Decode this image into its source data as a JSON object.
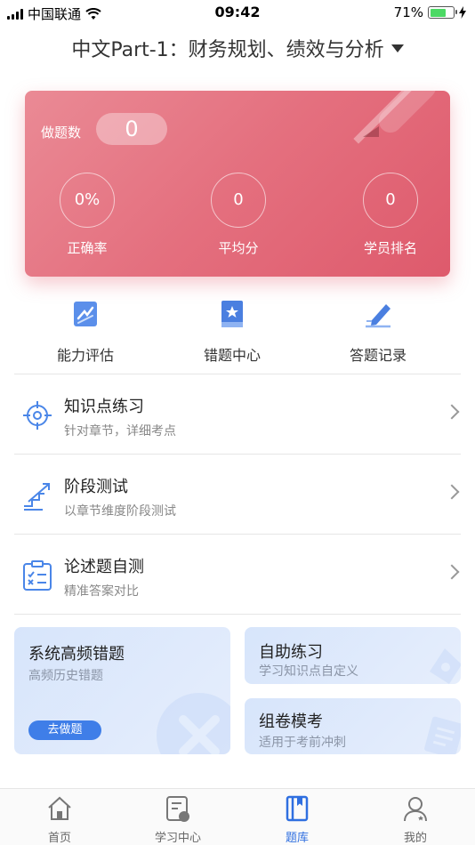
{
  "status_bar": {
    "carrier": "中国联通",
    "time": "09:42",
    "battery": "71%"
  },
  "header": {
    "title": "中文Part-1：财务规划、绩效与分析"
  },
  "stats": {
    "done_label": "做题数",
    "done_value": "0",
    "items": [
      {
        "value": "0%",
        "label": "正确率"
      },
      {
        "value": "0",
        "label": "平均分"
      },
      {
        "value": "0",
        "label": "学员排名"
      }
    ]
  },
  "quick_actions": [
    {
      "label": "能力评估",
      "icon": "ability-icon"
    },
    {
      "label": "错题中心",
      "icon": "wrong-book-icon"
    },
    {
      "label": "答题记录",
      "icon": "pen-record-icon"
    }
  ],
  "practice_list": [
    {
      "title": "知识点练习",
      "subtitle": "针对章节，详细考点",
      "icon": "target-icon"
    },
    {
      "title": "阶段测试",
      "subtitle": "以章节维度阶段测试",
      "icon": "stairs-icon"
    },
    {
      "title": "论述题自测",
      "subtitle": "精准答案对比",
      "icon": "clipboard-icon"
    }
  ],
  "feature_cards": {
    "high_freq": {
      "title": "系统高频错题",
      "subtitle": "高频历史错题",
      "button": "去做题"
    },
    "self_practice": {
      "title": "自助练习",
      "subtitle": "学习知识点自定义"
    },
    "mock_exam": {
      "title": "组卷模考",
      "subtitle": "适用于考前冲刺"
    }
  },
  "tabbar": [
    {
      "label": "首页",
      "icon": "home-icon",
      "active": false
    },
    {
      "label": "学习中心",
      "icon": "study-center-icon",
      "active": false
    },
    {
      "label": "题库",
      "icon": "question-bank-icon",
      "active": true
    },
    {
      "label": "我的",
      "icon": "profile-icon",
      "active": false
    }
  ],
  "colors": {
    "accent_blue": "#2f6fe0",
    "card_red": "#e46f7e",
    "icon_blue": "#4a86e8"
  }
}
